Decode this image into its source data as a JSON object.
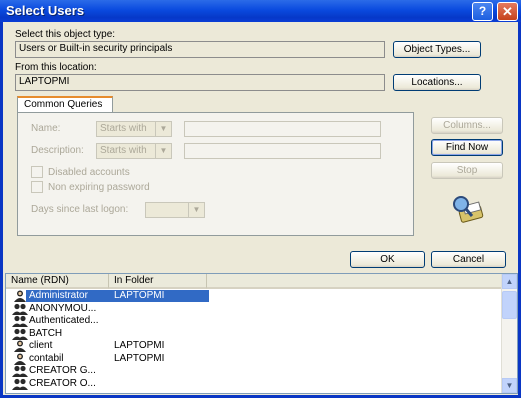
{
  "window": {
    "title": "Select Users",
    "help_btn": "?",
    "close_btn": "✕"
  },
  "object_type": {
    "label": "Select this object type:",
    "value": "Users or Built-in security principals",
    "button": "Object Types..."
  },
  "location": {
    "label": "From this location:",
    "value": "LAPTOPMI",
    "button": "Locations..."
  },
  "queries": {
    "tab": "Common Queries",
    "name_label": "Name:",
    "name_mode": "Starts with",
    "desc_label": "Description:",
    "desc_mode": "Starts with",
    "disabled_label": "Disabled accounts",
    "nonexpiring_label": "Non expiring password",
    "days_label": "Days since last logon:"
  },
  "side_buttons": {
    "columns": "Columns...",
    "find_now": "Find Now",
    "stop": "Stop"
  },
  "actions": {
    "ok": "OK",
    "cancel": "Cancel"
  },
  "results": {
    "columns": [
      "Name (RDN)",
      "In Folder"
    ],
    "rows": [
      {
        "name": "Administrator",
        "folder": "LAPTOPMI",
        "icon": "user-icon",
        "selected": true
      },
      {
        "name": "ANONYMOU...",
        "folder": "",
        "icon": "group-user-icon"
      },
      {
        "name": "Authenticated...",
        "folder": "",
        "icon": "group-user-icon"
      },
      {
        "name": "BATCH",
        "folder": "",
        "icon": "group-user-icon"
      },
      {
        "name": "client",
        "folder": "LAPTOPMI",
        "icon": "user-icon"
      },
      {
        "name": "contabil",
        "folder": "LAPTOPMI",
        "icon": "user-icon"
      },
      {
        "name": "CREATOR G...",
        "folder": "",
        "icon": "group-user-icon"
      },
      {
        "name": "CREATOR O...",
        "folder": "",
        "icon": "group-user-icon"
      }
    ]
  },
  "colors": {
    "title_bar": "#0a4adf",
    "selection": "#316ac5",
    "dialog_bg": "#ece9d8"
  }
}
